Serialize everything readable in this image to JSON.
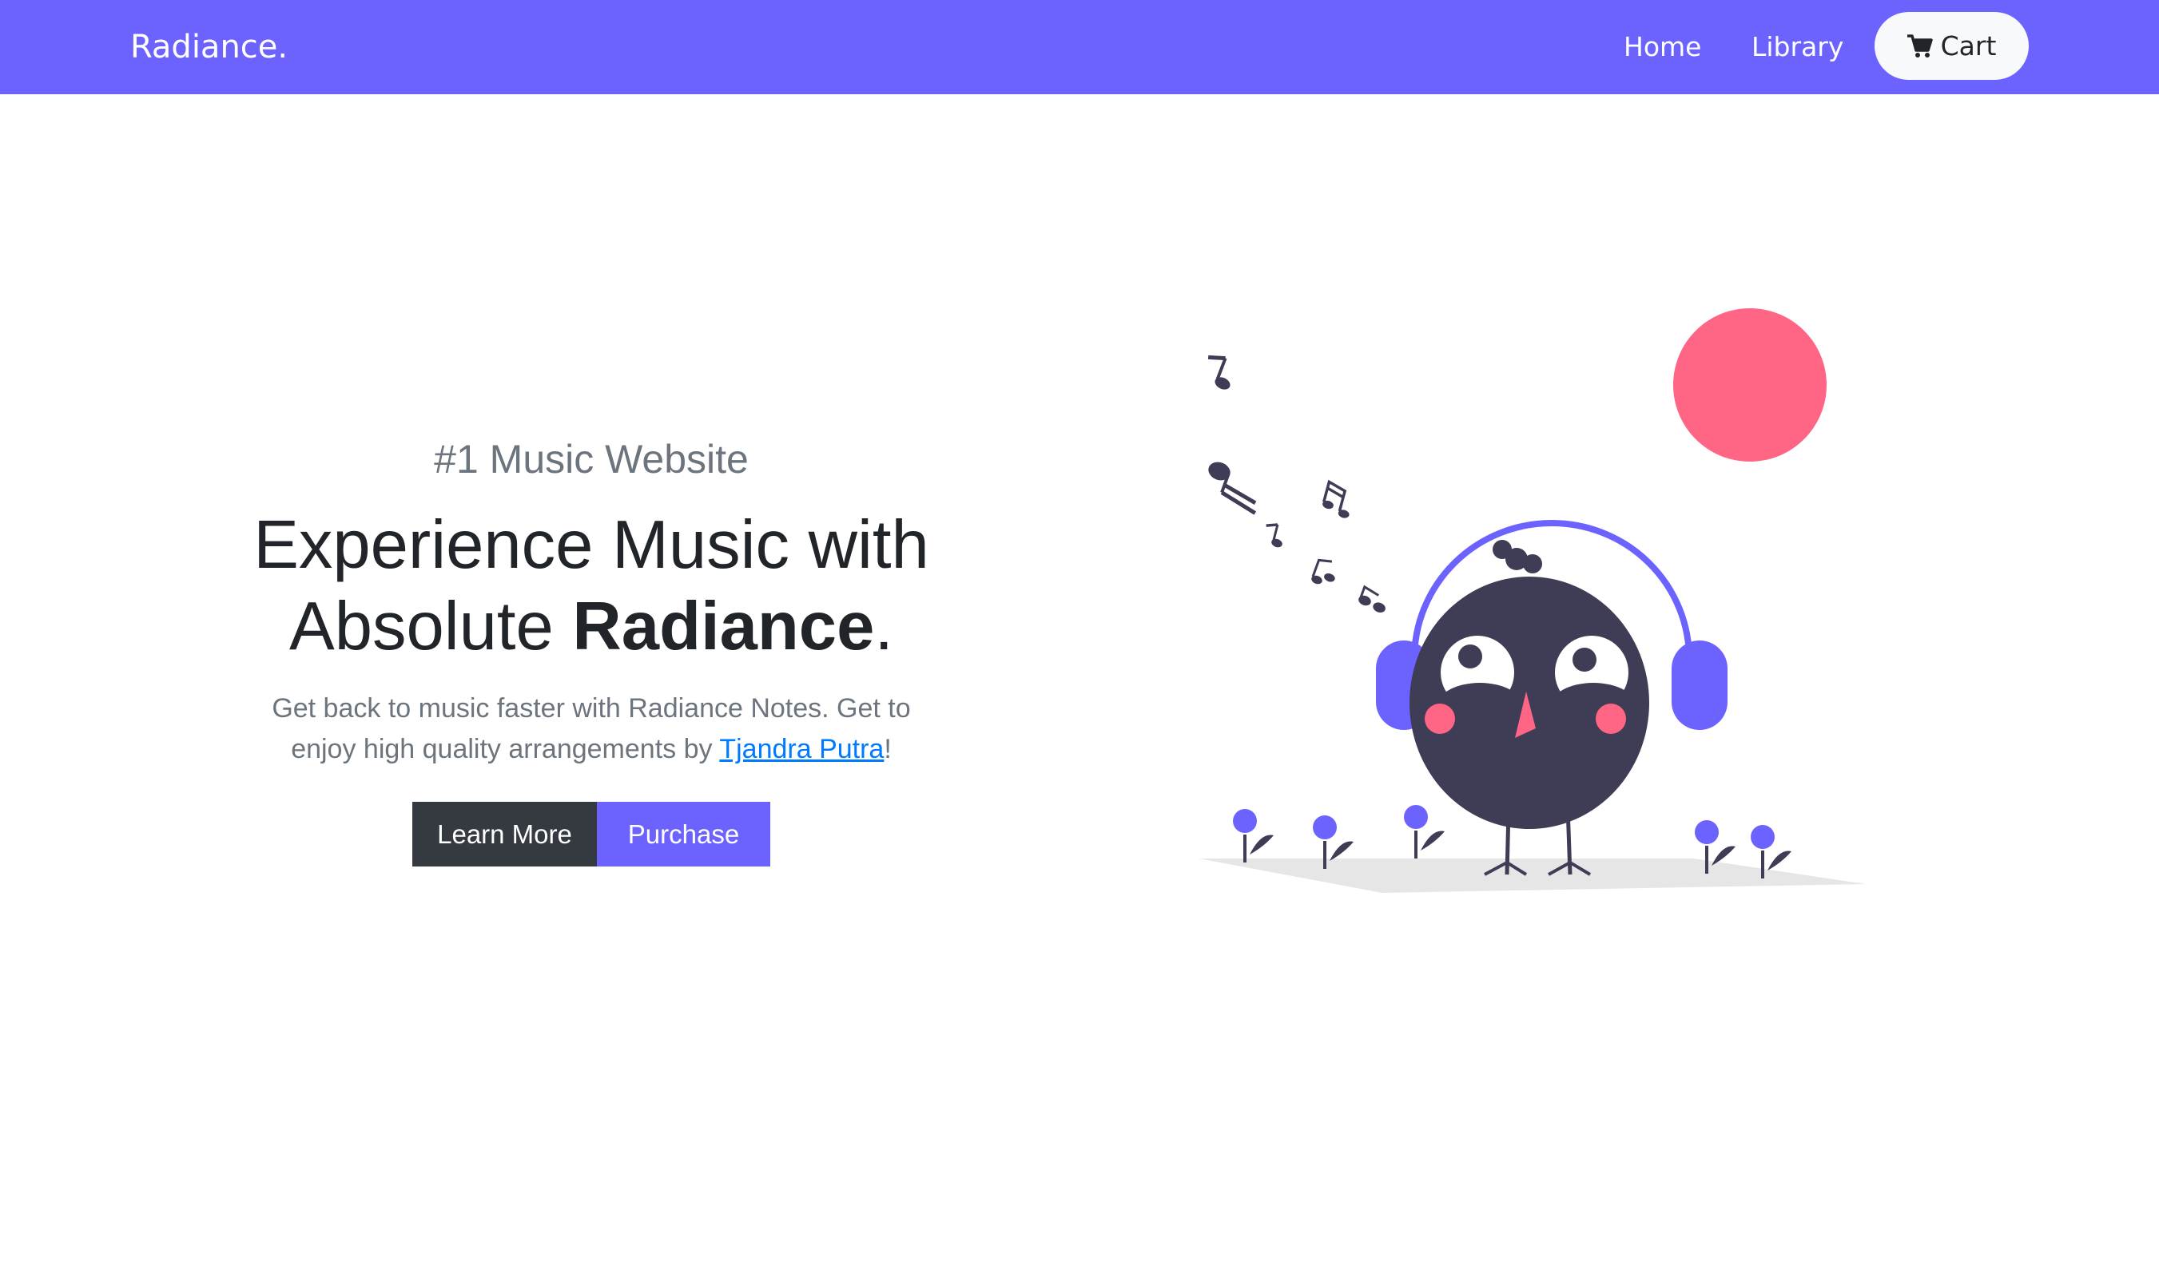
{
  "navbar": {
    "brand": "Radiance.",
    "links": [
      {
        "label": "Home"
      },
      {
        "label": "Library"
      }
    ],
    "cart_label": "Cart"
  },
  "hero": {
    "tagline": "#1 Music Website",
    "headline_line1": "Experience Music with",
    "headline_line2_prefix": "Absolute ",
    "headline_line2_bold": "Radiance",
    "headline_line2_suffix": ".",
    "lead_before_link": "Get back to music faster with Radiance Notes. Get to enjoy high quality arrangements by ",
    "lead_link": "Tjandra Putra",
    "lead_after_link": "!",
    "buttons": {
      "learn_more": "Learn More",
      "purchase": "Purchase"
    }
  },
  "colors": {
    "brand": "#6c63ff",
    "dark": "#343a40",
    "link": "#007bff",
    "muted": "#6c757d",
    "accent_pink": "#ff6584",
    "character": "#3f3d56"
  },
  "icons": {
    "cart": "shopping-cart-icon"
  }
}
